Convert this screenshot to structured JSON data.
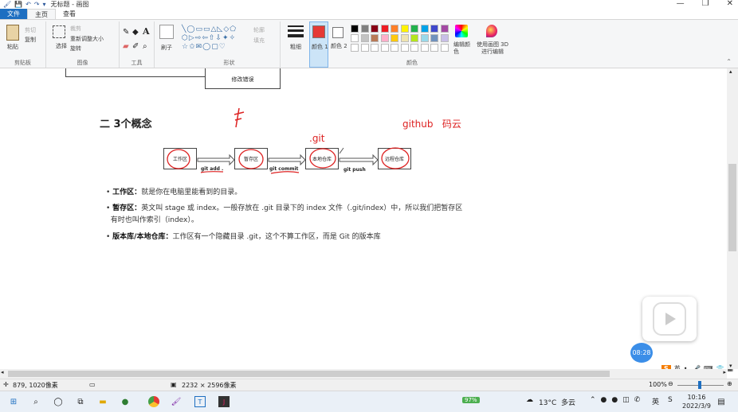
{
  "window": {
    "title": "无标题 - 画图",
    "controls": [
      "—",
      "❐",
      "✕"
    ]
  },
  "tabs": [
    {
      "label": "文件"
    },
    {
      "label": "主页"
    },
    {
      "label": "查看"
    }
  ],
  "ribbon": {
    "clipboard": {
      "group_label": "剪贴板",
      "paste": "粘贴",
      "cut": "剪切",
      "copy": "复制"
    },
    "image": {
      "group_label": "图像",
      "select": "选择",
      "crop": "裁剪",
      "resize": "重新调整大小",
      "rotate": "旋转"
    },
    "tools": {
      "group_label": "工具"
    },
    "brushes": {
      "label": "刷子"
    },
    "shapes": {
      "group_label": "形状",
      "outline": "轮廓",
      "fill": "填充"
    },
    "size": {
      "label": "粗细"
    },
    "color1": {
      "label": "颜色 1",
      "value": "#e53935"
    },
    "color2": {
      "label": "颜色 2",
      "value": "#ffffff"
    },
    "colors": {
      "group_label": "颜色",
      "edit": "编辑颜色",
      "paint3d": "使用画图 3D 进行编辑"
    },
    "palette_row1": [
      "#000000",
      "#7f7f7f",
      "#880015",
      "#ed1c24",
      "#ff7f27",
      "#fff200",
      "#22b14c",
      "#00a2e8",
      "#3f48cc",
      "#a349a4"
    ],
    "palette_row2": [
      "#ffffff",
      "#c3c3c3",
      "#b97a57",
      "#ffaec9",
      "#ffc90e",
      "#efe4b0",
      "#b5e61d",
      "#99d9ea",
      "#7092be",
      "#c8bfe7"
    ]
  },
  "document": {
    "top_box_label": "修改错误",
    "heading": "二 3个概念",
    "diagram": {
      "boxes": [
        "工作区",
        "暂存区",
        "本地仓库",
        "远程仓库"
      ],
      "arrows": [
        "git add .",
        "git commit",
        "git push"
      ],
      "annotations": {
        "git_dir": ".git",
        "remote": "github   码云"
      }
    },
    "bullets": [
      {
        "term": "工作区：",
        "text": "就是你在电脑里能看到的目录。"
      },
      {
        "term": "暂存区：",
        "text": "英文叫 stage 或 index。一般存放在 .git 目录下的 index 文件（.git/index）中，所以我们把暂存区",
        "text2": "有时也叫作索引（index）。"
      },
      {
        "term": "版本库/本地仓库：",
        "text": "工作区有一个隐藏目录 .git，这个不算工作区，而是 Git 的版本库"
      }
    ]
  },
  "video": {
    "time": "08:28"
  },
  "ime": {
    "label": "英"
  },
  "status": {
    "cursor": "879, 1020像素",
    "size": "2232 × 2596像素",
    "zoom": "100%"
  },
  "taskbar": {
    "battery": "97%",
    "weather": "13°C  多云",
    "time": "10:16",
    "date": "2022/3/9"
  }
}
